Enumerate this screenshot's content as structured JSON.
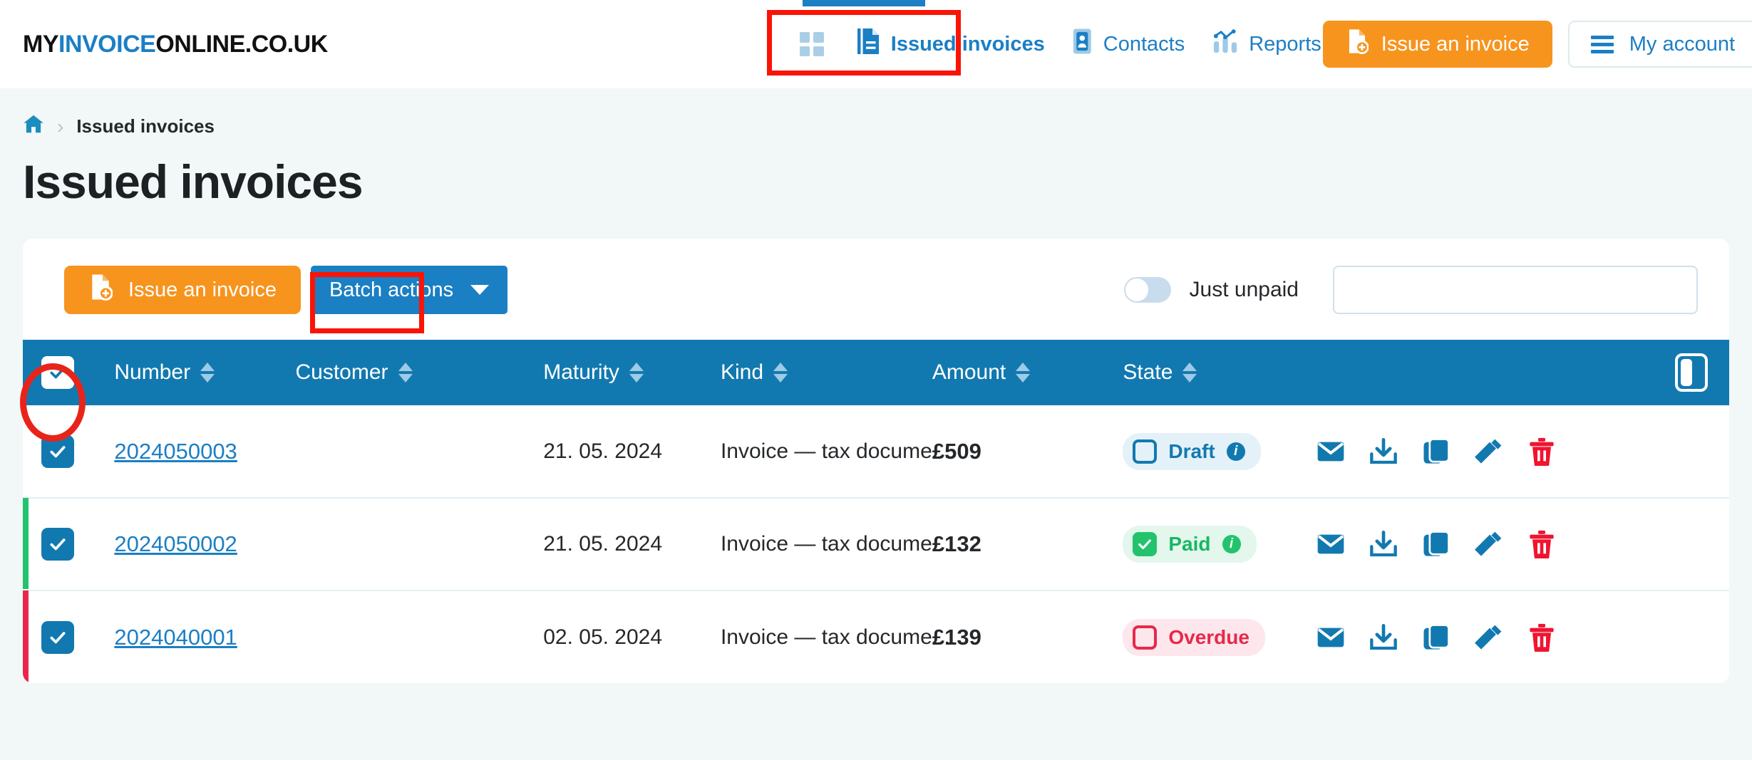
{
  "brand": {
    "logo_part1": "MY",
    "logo_part2": "INVOICE",
    "logo_part3": "ONLINE.CO.UK"
  },
  "header": {
    "nav": [
      {
        "label": "",
        "icon": "dashboard-grid-icon"
      },
      {
        "label": "Issued invoices",
        "icon": "document-icon"
      },
      {
        "label": "Contacts",
        "icon": "contact-card-icon"
      },
      {
        "label": "Reports",
        "icon": "chart-icon"
      }
    ],
    "issue_invoice_label": "Issue an invoice",
    "my_account_label": "My account"
  },
  "breadcrumb": {
    "home_icon": "home-icon",
    "separator": "›",
    "current": "Issued invoices"
  },
  "page": {
    "title": "Issued invoices"
  },
  "toolbar": {
    "issue_invoice_label": "Issue an invoice",
    "batch_actions_label": "Batch actions",
    "just_unpaid_label": "Just unpaid",
    "just_unpaid_on": false,
    "search_value": "",
    "search_placeholder": ""
  },
  "table": {
    "columns": [
      {
        "key": "checkbox",
        "label": "",
        "sortable": false
      },
      {
        "key": "number",
        "label": "Number",
        "sortable": true
      },
      {
        "key": "customer",
        "label": "Customer",
        "sortable": true
      },
      {
        "key": "maturity",
        "label": "Maturity",
        "sortable": true
      },
      {
        "key": "kind",
        "label": "Kind",
        "sortable": true
      },
      {
        "key": "amount",
        "label": "Amount",
        "sortable": true
      },
      {
        "key": "state",
        "label": "State",
        "sortable": true
      },
      {
        "key": "actions",
        "label": "",
        "sortable": false
      }
    ],
    "select_all_checked": true,
    "column_settings_icon": "columns-toggle-icon",
    "rows": [
      {
        "checked": true,
        "number": "2024050003",
        "customer": "",
        "maturity": "21. 05. 2024",
        "kind": "Invoice — tax docume...",
        "amount": "£509",
        "state": "Draft",
        "state_kind": "draft",
        "state_has_info": true,
        "bar_color": ""
      },
      {
        "checked": true,
        "number": "2024050002",
        "customer": "",
        "maturity": "21. 05. 2024",
        "kind": "Invoice — tax docume...",
        "amount": "£132",
        "state": "Paid",
        "state_kind": "paid",
        "state_has_info": true,
        "bar_color": "#23c36e"
      },
      {
        "checked": true,
        "number": "2024040001",
        "customer": "",
        "maturity": "02. 05. 2024",
        "kind": "Invoice — tax docume...",
        "amount": "£139",
        "state": "Overdue",
        "state_kind": "overdue",
        "state_has_info": false,
        "bar_color": "#e8284a"
      }
    ],
    "row_actions": [
      {
        "name": "send-email-icon",
        "title": "Send by e-mail"
      },
      {
        "name": "download-icon",
        "title": "Download"
      },
      {
        "name": "duplicate-icon",
        "title": "Duplicate"
      },
      {
        "name": "edit-pencil-icon",
        "title": "Edit"
      },
      {
        "name": "delete-trash-icon",
        "title": "Delete"
      }
    ]
  },
  "colors": {
    "brand_blue": "#1b7fc4",
    "table_header_blue": "#1279b0",
    "orange": "#f7941e",
    "green": "#23c36e",
    "red": "#e8284a",
    "annotation_red": "#fa1405",
    "page_bg": "#f2f7f8"
  }
}
